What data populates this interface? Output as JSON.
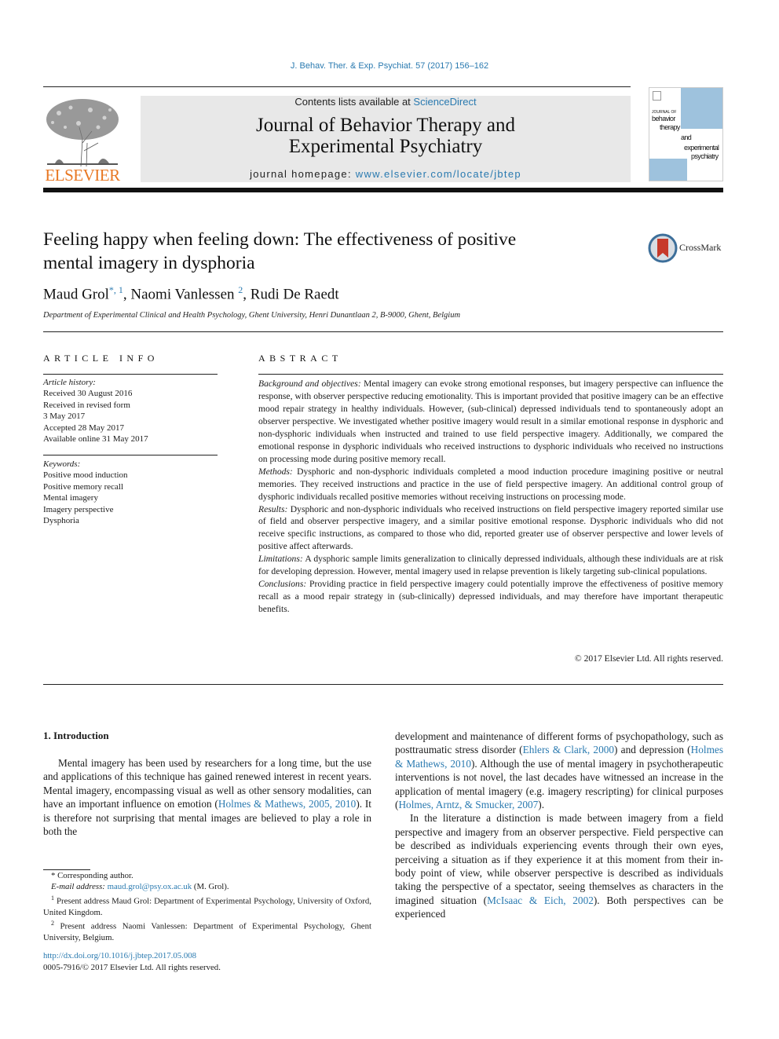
{
  "header": {
    "citation": "J. Behav. Ther. & Exp. Psychiat. 57 (2017) 156–162",
    "publisher_logo_text": "ELSEVIER",
    "contents_prefix": "Contents lists available at ",
    "contents_link": "ScienceDirect",
    "journal_title_line1": "Journal of Behavior Therapy and",
    "journal_title_line2": "Experimental Psychiatry",
    "homepage_prefix": "journal homepage: ",
    "homepage_link": "www.elsevier.com/locate/jbtep",
    "cover": {
      "line1": "JOURNAL OF",
      "line2": "behavior",
      "line3": "therapy",
      "line4": "and",
      "line5": "experimental",
      "line6": "psychiatry"
    },
    "colors": {
      "link": "#2a7ab0",
      "elsevier_orange": "#e87722",
      "banner_gray": "#e8e8e8",
      "cover_blue": "#9ec2dd"
    }
  },
  "article": {
    "title_line1": "Feeling happy when feeling down: The effectiveness of positive",
    "title_line2": "mental imagery in dysphoria",
    "crossmark_label": "CrossMark",
    "authors": [
      {
        "name": "Maud Grol",
        "marks": "*, 1"
      },
      {
        "name": "Naomi Vanlessen",
        "marks": "2"
      },
      {
        "name": "Rudi De Raedt",
        "marks": ""
      }
    ],
    "affiliation": "Department of Experimental Clinical and Health Psychology, Ghent University, Henri Dunantlaan 2, B-9000, Ghent, Belgium"
  },
  "article_info": {
    "heading": "ARTICLE INFO",
    "history_label": "Article history:",
    "history": [
      "Received 30 August 2016",
      "Received in revised form",
      "3 May 2017",
      "Accepted 28 May 2017",
      "Available online 31 May 2017"
    ],
    "keywords_label": "Keywords:",
    "keywords": [
      "Positive mood induction",
      "Positive memory recall",
      "Mental imagery",
      "Imagery perspective",
      "Dysphoria"
    ]
  },
  "abstract": {
    "heading": "ABSTRACT",
    "sections": [
      {
        "label": "Background and objectives:",
        "text": " Mental imagery can evoke strong emotional responses, but imagery perspective can influence the response, with observer perspective reducing emotionality. This is important provided that positive imagery can be an effective mood repair strategy in healthy individuals. However, (sub-clinical) depressed individuals tend to spontaneously adopt an observer perspective. We investigated whether positive imagery would result in a similar emotional response in dysphoric and non-dysphoric individuals when instructed and trained to use field perspective imagery. Additionally, we compared the emotional response in dysphoric individuals who received instructions to dysphoric individuals who received no instructions on processing mode during positive memory recall."
      },
      {
        "label": "Methods:",
        "text": " Dysphoric and non-dysphoric individuals completed a mood induction procedure imagining positive or neutral memories. They received instructions and practice in the use of field perspective imagery. An additional control group of dysphoric individuals recalled positive memories without receiving instructions on processing mode."
      },
      {
        "label": "Results:",
        "text": " Dysphoric and non-dysphoric individuals who received instructions on field perspective imagery reported similar use of field and observer perspective imagery, and a similar positive emotional response. Dysphoric individuals who did not receive specific instructions, as compared to those who did, reported greater use of observer perspective and lower levels of positive affect afterwards."
      },
      {
        "label": "Limitations:",
        "text": " A dysphoric sample limits generalization to clinically depressed individuals, although these individuals are at risk for developing depression. However, mental imagery used in relapse prevention is likely targeting sub-clinical populations."
      },
      {
        "label": "Conclusions:",
        "text": " Providing practice in field perspective imagery could potentially improve the effectiveness of positive memory recall as a mood repair strategy in (sub-clinically) depressed individuals, and may therefore have important therapeutic benefits."
      }
    ],
    "copyright": "© 2017 Elsevier Ltd. All rights reserved."
  },
  "body": {
    "section_heading": "1.  Introduction",
    "left_p1_a": "Mental imagery has been used by researchers for a long time, but the use and applications of this technique has gained renewed interest in recent years. Mental imagery, encompassing visual as well as other sensory modalities, can have an important influence on emotion (",
    "left_p1_cite": "Holmes & Mathews, 2005, 2010",
    "left_p1_b": "). It is therefore not surprising that mental images are believed to play a role in both the",
    "right_p1_a": "development and maintenance of different forms of psychopathology, such as posttraumatic stress disorder (",
    "right_p1_cite1": "Ehlers & Clark, 2000",
    "right_p1_b": ") and depression (",
    "right_p1_cite2": "Holmes & Mathews, 2010",
    "right_p1_c": "). Although the use of mental imagery in psychotherapeutic interventions is not novel, the last decades have witnessed an increase in the application of mental imagery (e.g. imagery rescripting) for clinical purposes (",
    "right_p1_cite3": "Holmes, Arntz, & Smucker, 2007",
    "right_p1_d": ").",
    "right_p2_a": "In the literature a distinction is made between imagery from a field perspective and imagery from an observer perspective. Field perspective can be described as individuals experiencing events through their own eyes, perceiving a situation as if they experience it at this moment from their in-body point of view, while observer perspective is described as individuals taking the perspective of a spectator, seeing themselves as characters in the imagined situation (",
    "right_p2_cite": "McIsaac & Eich, 2002",
    "right_p2_b": "). Both perspectives can be experienced"
  },
  "footnotes": {
    "corresponding_mark": "*",
    "corresponding": " Corresponding author.",
    "email_label": "E-mail address:",
    "email": "maud.grol@psy.ox.ac.uk",
    "email_suffix": " (M. Grol).",
    "fn1_mark": "1",
    "fn1": " Present address Maud Grol: Department of Experimental Psychology, University of Oxford, United Kingdom.",
    "fn2_mark": "2",
    "fn2": " Present address Naomi Vanlessen: Department of Experimental Psychology, Ghent University, Belgium.",
    "doi": "http://dx.doi.org/10.1016/j.jbtep.2017.05.008",
    "issn": "0005-7916/© 2017 Elsevier Ltd. All rights reserved."
  }
}
